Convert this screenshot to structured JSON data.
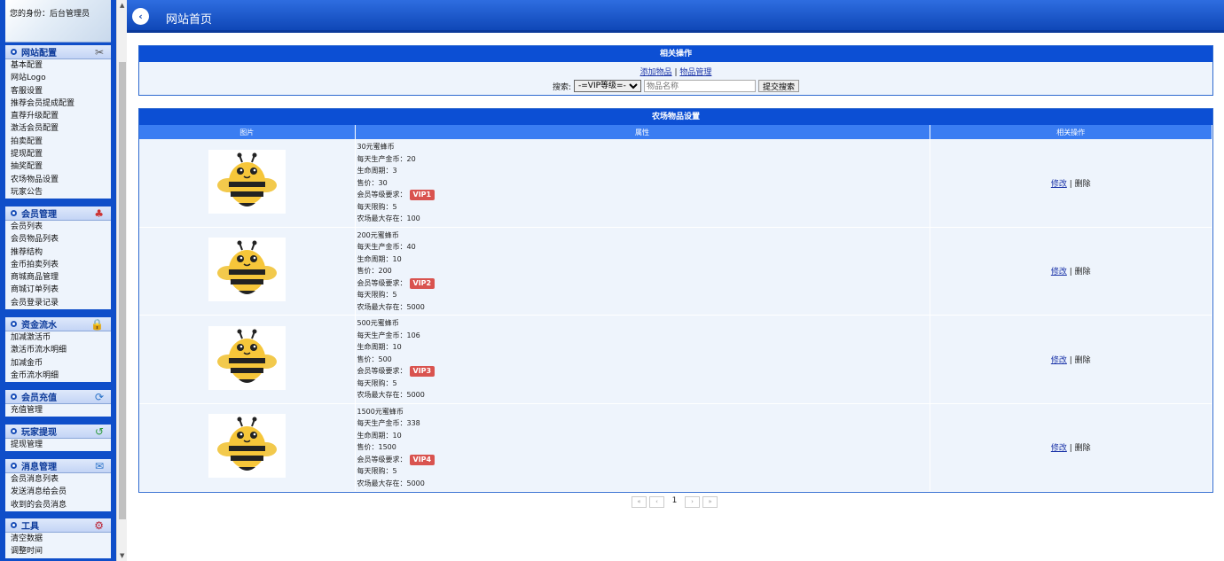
{
  "sidebar": {
    "user_label": "您的身份：后台管理员",
    "sections": [
      {
        "title": "网站配置",
        "icon": "tools-icon",
        "items": [
          "基本配置",
          "网站Logo",
          "客服设置",
          "推荐会员提成配置",
          "直荐升级配置",
          "激活会员配置",
          "拍卖配置",
          "提现配置",
          "抽奖配置",
          "农场物品设置",
          "玩家公告"
        ]
      },
      {
        "title": "会员管理",
        "icon": "users-icon",
        "items": [
          "会员列表",
          "会员物品列表",
          "推荐结构",
          "金币拍卖列表",
          "商城商品管理",
          "商城订单列表",
          "会员登录记录"
        ]
      },
      {
        "title": "资金流水",
        "icon": "lock-icon",
        "items": [
          "加减激活币",
          "激活币流水明细",
          "加减金币",
          "金币流水明细"
        ]
      },
      {
        "title": "会员充值",
        "icon": "recharge-icon",
        "items": [
          "充值管理"
        ]
      },
      {
        "title": "玩家提现",
        "icon": "withdraw-icon",
        "items": [
          "提现管理"
        ]
      },
      {
        "title": "消息管理",
        "icon": "message-icon",
        "items": [
          "会员消息列表",
          "发送消息给会员",
          "收到的会员消息"
        ]
      },
      {
        "title": "工具",
        "icon": "tool-icon",
        "items": [
          "清空数据",
          "调整时间"
        ]
      }
    ]
  },
  "header": {
    "title": "网站首页",
    "back_icon": "back-arrow-icon"
  },
  "ops_panel": {
    "title": "相关操作",
    "link_add": "添加物品",
    "separator": "|",
    "link_manage": "物品管理",
    "search_label": "搜索:",
    "select_value": "-=VIP等级=-",
    "input_placeholder": "物品名称",
    "submit_label": "提交搜索"
  },
  "items_panel": {
    "title": "农场物品设置",
    "columns": [
      "图片",
      "属性",
      "相关操作"
    ],
    "rows": [
      {
        "name": "30元蜜蜂币",
        "daily": "每天生产金币：20",
        "cycle": "生命周期：3",
        "price": "售价：30",
        "vip_label": "会员等级要求：",
        "vip": "VIP1",
        "limit": "每天限购：5",
        "max": "农场最大存在：100",
        "edit": "修改",
        "sep": "|",
        "del": "删除"
      },
      {
        "name": "200元蜜蜂币",
        "daily": "每天生产金币：40",
        "cycle": "生命周期：10",
        "price": "售价：200",
        "vip_label": "会员等级要求：",
        "vip": "VIP2",
        "limit": "每天限购：5",
        "max": "农场最大存在：5000",
        "edit": "修改",
        "sep": "|",
        "del": "删除"
      },
      {
        "name": "500元蜜蜂币",
        "daily": "每天生产金币：106",
        "cycle": "生命周期：10",
        "price": "售价：500",
        "vip_label": "会员等级要求：",
        "vip": "VIP3",
        "limit": "每天限购：5",
        "max": "农场最大存在：5000",
        "edit": "修改",
        "sep": "|",
        "del": "删除"
      },
      {
        "name": "1500元蜜蜂币",
        "daily": "每天生产金币：338",
        "cycle": "生命周期：10",
        "price": "售价：1500",
        "vip_label": "会员等级要求：",
        "vip": "VIP4",
        "limit": "每天限购：5",
        "max": "农场最大存在：5000",
        "edit": "修改",
        "sep": "|",
        "del": "删除"
      }
    ]
  },
  "pager": {
    "first": "«",
    "prev": "‹",
    "current": "1",
    "next": "›",
    "last": "»"
  },
  "colors": {
    "primary": "#0c4fd4",
    "header_bg": "#1a55c8",
    "vip_badge": "#d9534f",
    "panel_bg": "#eef4fc"
  }
}
